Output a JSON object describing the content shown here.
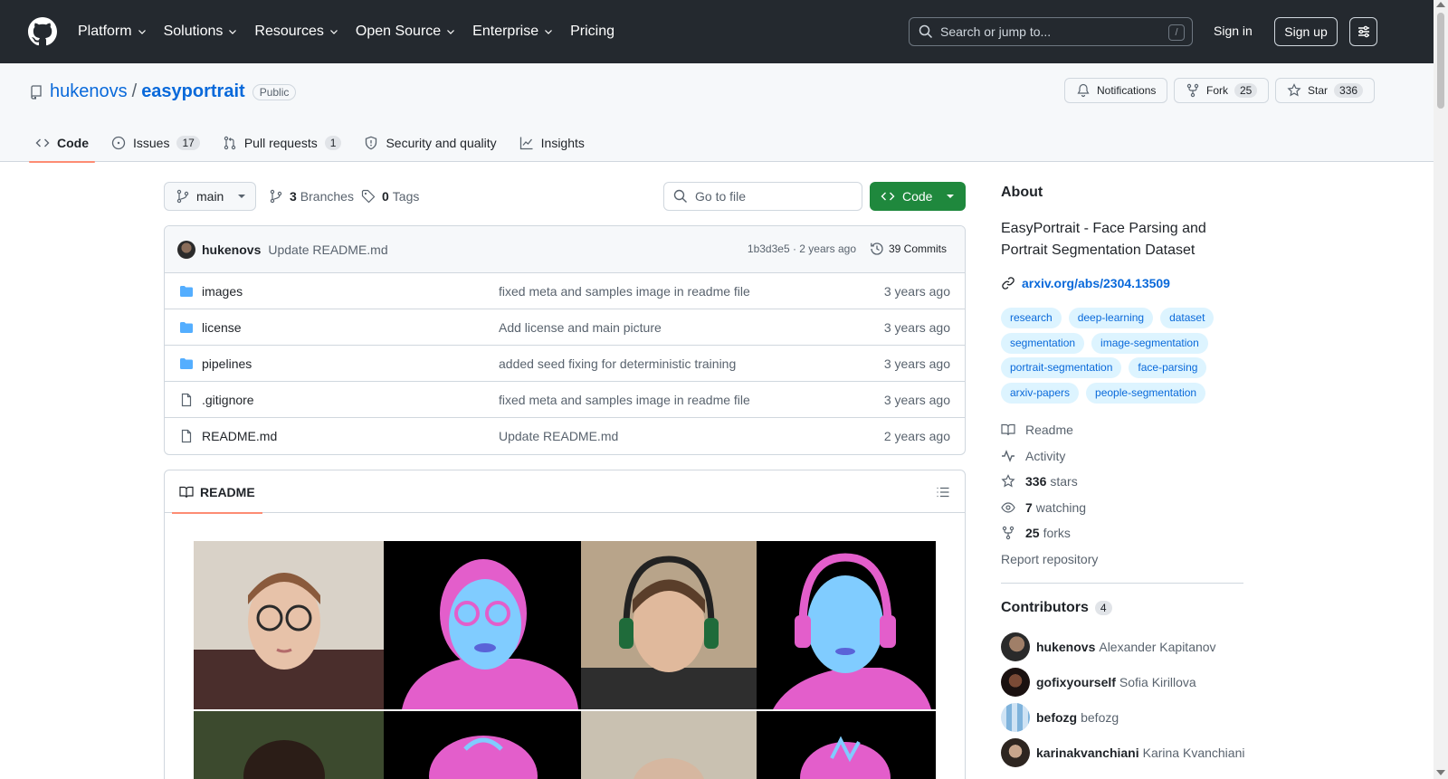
{
  "header": {
    "nav": [
      {
        "label": "Platform",
        "has_menu": true
      },
      {
        "label": "Solutions",
        "has_menu": true
      },
      {
        "label": "Resources",
        "has_menu": true
      },
      {
        "label": "Open Source",
        "has_menu": true
      },
      {
        "label": "Enterprise",
        "has_menu": true
      },
      {
        "label": "Pricing",
        "has_menu": false
      }
    ],
    "search_placeholder": "Search or jump to...",
    "search_shortcut": "/",
    "signin": "Sign in",
    "signup": "Sign up"
  },
  "repo": {
    "owner": "hukenovs",
    "separator": "/",
    "name": "easyportrait",
    "visibility": "Public",
    "notifications_label": "Notifications",
    "fork_label": "Fork",
    "fork_count": "25",
    "star_label": "Star",
    "star_count": "336"
  },
  "tabs": [
    {
      "label": "Code",
      "count": "",
      "active": true
    },
    {
      "label": "Issues",
      "count": "17",
      "active": false
    },
    {
      "label": "Pull requests",
      "count": "1",
      "active": false
    },
    {
      "label": "Security and quality",
      "count": "",
      "active": false
    },
    {
      "label": "Insights",
      "count": "",
      "active": false
    }
  ],
  "controls": {
    "branch": "main",
    "branches_count": "3",
    "branches_label": "Branches",
    "tags_count": "0",
    "tags_label": "Tags",
    "goto_file_placeholder": "Go to file",
    "code_button": "Code"
  },
  "latest_commit": {
    "author": "hukenovs",
    "message": "Update README.md",
    "meta": "1b3d3e5 · 2 years ago",
    "commits_label": "39 Commits"
  },
  "files": [
    {
      "name": "images",
      "type": "dir",
      "message": "fixed meta and samples image in readme file",
      "age": "3 years ago"
    },
    {
      "name": "license",
      "type": "dir",
      "message": "Add license and main picture",
      "age": "3 years ago"
    },
    {
      "name": "pipelines",
      "type": "dir",
      "message": "added seed fixing for deterministic training",
      "age": "3 years ago"
    },
    {
      "name": ".gitignore",
      "type": "file",
      "message": "fixed meta and samples image in readme file",
      "age": "3 years ago"
    },
    {
      "name": "README.md",
      "type": "file",
      "message": "Update README.md",
      "age": "2 years ago"
    }
  ],
  "readme": {
    "tab_label": "README"
  },
  "about": {
    "heading": "About",
    "description": "EasyPortrait - Face Parsing and Portrait Segmentation Dataset",
    "link": "arxiv.org/abs/2304.13509",
    "topics": [
      "research",
      "deep-learning",
      "dataset",
      "segmentation",
      "image-segmentation",
      "portrait-segmentation",
      "face-parsing",
      "arxiv-papers",
      "people-segmentation"
    ],
    "readme": "Readme",
    "activity": "Activity",
    "stars_count": "336",
    "stars_label": "stars",
    "watching_count": "7",
    "watching_label": "watching",
    "forks_count": "25",
    "forks_label": "forks",
    "report": "Report repository"
  },
  "contributors": {
    "heading": "Contributors",
    "count": "4",
    "list": [
      {
        "login": "hukenovs",
        "name": "Alexander Kapitanov"
      },
      {
        "login": "gofixyourself",
        "name": "Sofia Kirillova"
      },
      {
        "login": "befozg",
        "name": "befozg"
      },
      {
        "login": "karinakvanchiani",
        "name": "Karina Kvanchiani"
      }
    ]
  },
  "colors": {
    "accent": "#0969da",
    "header_bg": "#24292f",
    "code_button": "#1f883d",
    "tab_underline": "#fd8c73",
    "folder": "#54aeff",
    "segment_face": "#80ccff",
    "segment_hair": "#e35ecb"
  }
}
